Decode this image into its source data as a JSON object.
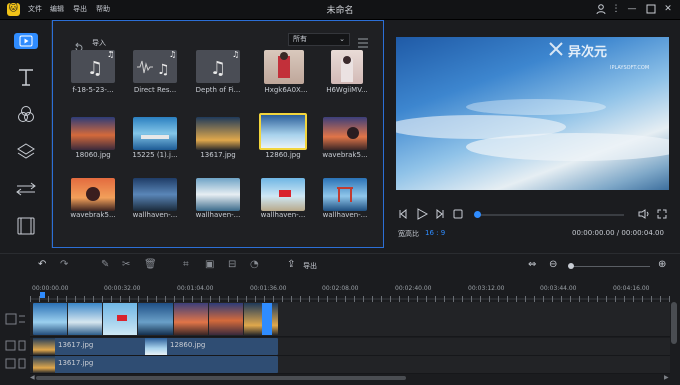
{
  "app": {
    "title": "未命名",
    "logo": "🐱"
  },
  "menu": [
    "文件",
    "编辑",
    "导出",
    "帮助"
  ],
  "window_controls": [
    "user-icon",
    "minimize-icon",
    "maximize-icon",
    "close-icon"
  ],
  "media_panel": {
    "import_label": "导入",
    "filter_value": "所有",
    "items": [
      {
        "name": "f-18-5-23-...",
        "type": "audio"
      },
      {
        "name": "Direct Res...",
        "type": "audio"
      },
      {
        "name": "Depth of Fi...",
        "type": "audio"
      },
      {
        "name": "Hxgk6A0X...",
        "type": "image"
      },
      {
        "name": "H6WgiiMV...",
        "type": "image"
      },
      {
        "name": "18060.jpg",
        "type": "image"
      },
      {
        "name": "15225 (1).j...",
        "type": "image"
      },
      {
        "name": "13617.jpg",
        "type": "image"
      },
      {
        "name": "12860.jpg",
        "type": "image",
        "selected": true
      },
      {
        "name": "wavebrak5...",
        "type": "image"
      },
      {
        "name": "wavebrak5...",
        "type": "image"
      },
      {
        "name": "wallhaven-...",
        "type": "image"
      },
      {
        "name": "wallhaven-...",
        "type": "image"
      },
      {
        "name": "wallhaven-...",
        "type": "image"
      },
      {
        "name": "wallhaven-...",
        "type": "image"
      }
    ]
  },
  "preview": {
    "watermark_cn": "异次元",
    "watermark_en": "IPLAYSOFT.COM",
    "aspect_label": "宽高比",
    "aspect_value": "16 : 9",
    "time": "00:00:00.00 / 00:00:04.00"
  },
  "timeline": {
    "export_label": "导出",
    "ruler": [
      "00:00:00.00",
      "00:00:32.00",
      "00:01:04.00",
      "00:01:36.00",
      "00:02:08.00",
      "00:02:40.00",
      "00:03:12.00",
      "00:03:44.00",
      "00:04:16.00"
    ],
    "clips": {
      "track2_a": "13617.jpg",
      "track2_b": "12860.jpg",
      "track3": "13617.jpg"
    }
  },
  "colors": {
    "accent": "#2f8cff",
    "selected_border": "#f2d53c",
    "clip_blue": "#2f4d73"
  }
}
